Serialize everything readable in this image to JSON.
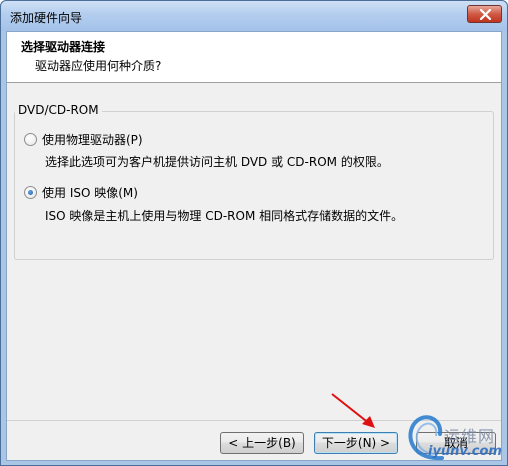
{
  "window": {
    "title": "添加硬件向导"
  },
  "header": {
    "title": "选择驱动器连接",
    "subtitle": "驱动器应使用何种介质?"
  },
  "group": {
    "label": "DVD/CD-ROM"
  },
  "options": [
    {
      "label": "使用物理驱动器(P)",
      "description": "选择此选项可为客户机提供访问主机 DVD 或 CD-ROM 的权限。",
      "checked": false
    },
    {
      "label": "使用 ISO 映像(M)",
      "description": "ISO 映像是主机上使用与物理 CD-ROM 相同格式存储数据的文件。",
      "checked": true
    }
  ],
  "buttons": {
    "back": "< 上一步(B)",
    "next": "下一步(N) >",
    "cancel": "取消"
  },
  "icons": {
    "close": "close-icon",
    "arrow": "red-arrow-annotation",
    "watermark": "watermark-logo"
  },
  "watermark": {
    "cn": "运维网",
    "en": "iyunv.com"
  },
  "colors": {
    "accent": "#3c7fb1",
    "arrow": "#e01010"
  }
}
